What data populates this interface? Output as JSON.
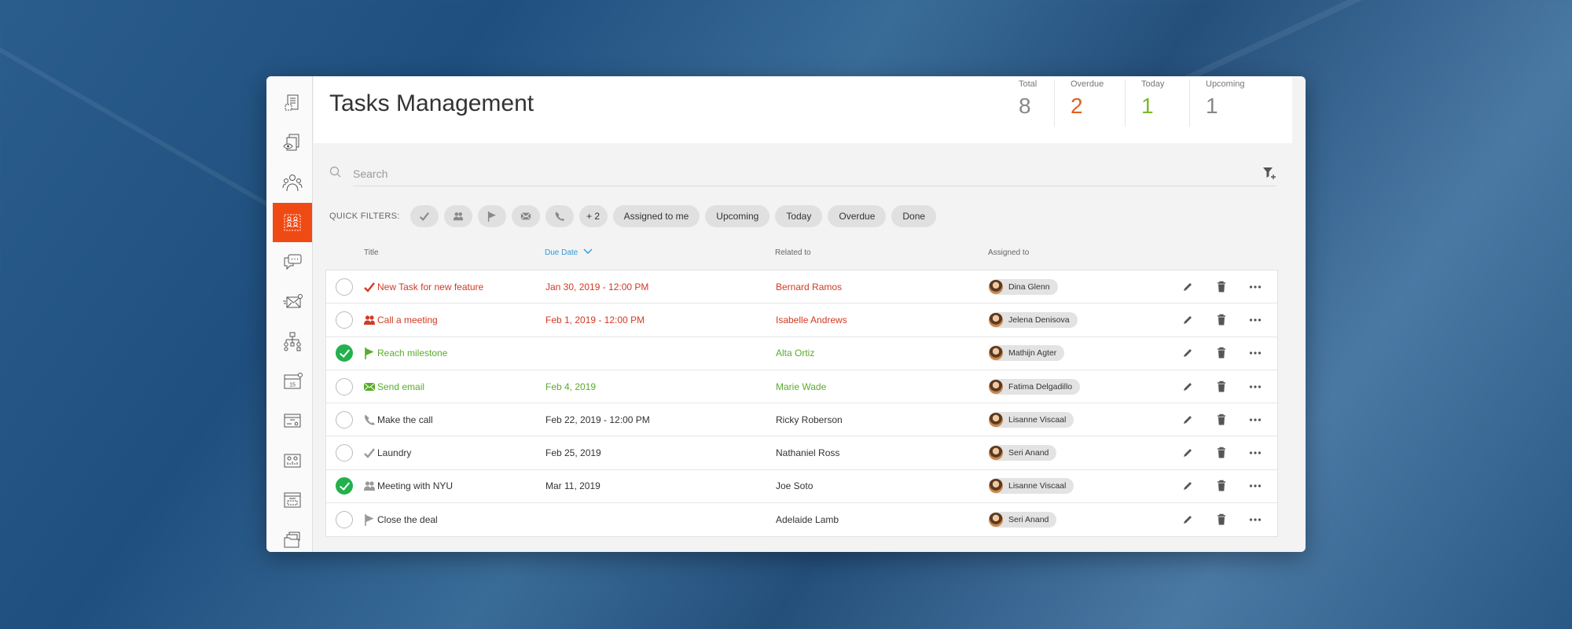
{
  "sidebar": {
    "items": [
      {
        "icon": "document-icon"
      },
      {
        "icon": "preview-icon"
      },
      {
        "icon": "team-icon"
      },
      {
        "icon": "tasks-icon",
        "active": true
      },
      {
        "icon": "chat-icon"
      },
      {
        "icon": "mail-icon"
      },
      {
        "icon": "hierarchy-icon"
      },
      {
        "icon": "calendar-icon",
        "day": "15"
      },
      {
        "icon": "form-icon"
      },
      {
        "icon": "report-icon"
      },
      {
        "icon": "template-icon"
      },
      {
        "icon": "files-icon"
      }
    ]
  },
  "header": {
    "title": "Tasks Management",
    "stats": [
      {
        "label": "Total",
        "value": "8",
        "color": "#888888"
      },
      {
        "label": "Overdue",
        "value": "2",
        "color": "#e0601f"
      },
      {
        "label": "Today",
        "value": "1",
        "color": "#7ab92b"
      },
      {
        "label": "Upcoming",
        "value": "1",
        "color": "#888888"
      }
    ]
  },
  "search": {
    "placeholder": "Search",
    "value": ""
  },
  "quick_filters": {
    "label": "QUICK FILTERS:",
    "icon_chips": [
      "check-icon",
      "meeting-icon",
      "flag-icon",
      "email-icon",
      "phone-icon"
    ],
    "more": "+ 2",
    "chips": [
      "Assigned to me",
      "Upcoming",
      "Today",
      "Overdue",
      "Done"
    ]
  },
  "table": {
    "columns": {
      "title": "Title",
      "due": "Due Date",
      "related": "Related to",
      "assigned": "Assigned to"
    },
    "rows": [
      {
        "done": false,
        "type": "check",
        "title": "New Task for new feature",
        "due": "Jan 30, 2019 - 12:00 PM",
        "related": "Bernard Ramos",
        "assigned": "Dina Glenn",
        "status": "red"
      },
      {
        "done": false,
        "type": "meeting",
        "title": "Call a meeting",
        "due": "Feb 1, 2019 - 12:00 PM",
        "related": "Isabelle Andrews",
        "assigned": "Jelena Denisova",
        "status": "red"
      },
      {
        "done": true,
        "type": "flag",
        "title": "Reach milestone",
        "due": "",
        "related": "Alta Ortiz",
        "assigned": "Mathijn Agter",
        "status": "green"
      },
      {
        "done": false,
        "type": "email",
        "title": "Send email",
        "due": "Feb 4, 2019",
        "related": "Marie Wade",
        "assigned": "Fatima Delgadillo",
        "status": "green"
      },
      {
        "done": false,
        "type": "phone",
        "title": "Make the call",
        "due": "Feb 22, 2019 - 12:00 PM",
        "related": "Ricky Roberson",
        "assigned": "Lisanne Viscaal",
        "status": ""
      },
      {
        "done": false,
        "type": "check",
        "title": "Laundry",
        "due": "Feb 25, 2019",
        "related": "Nathaniel Ross",
        "assigned": "Seri Anand",
        "status": ""
      },
      {
        "done": true,
        "type": "meeting",
        "title": "Meeting with NYU",
        "due": "Mar 11, 2019",
        "related": "Joe Soto",
        "assigned": "Lisanne Viscaal",
        "status": ""
      },
      {
        "done": false,
        "type": "flag",
        "title": "Close the deal",
        "due": "",
        "related": "Adelaide Lamb",
        "assigned": "Seri Anand",
        "status": ""
      }
    ]
  },
  "colors": {
    "accent": "#f04a14",
    "red": "#d13a24",
    "green": "#5aac2c",
    "sort": "#2d9ad6"
  }
}
